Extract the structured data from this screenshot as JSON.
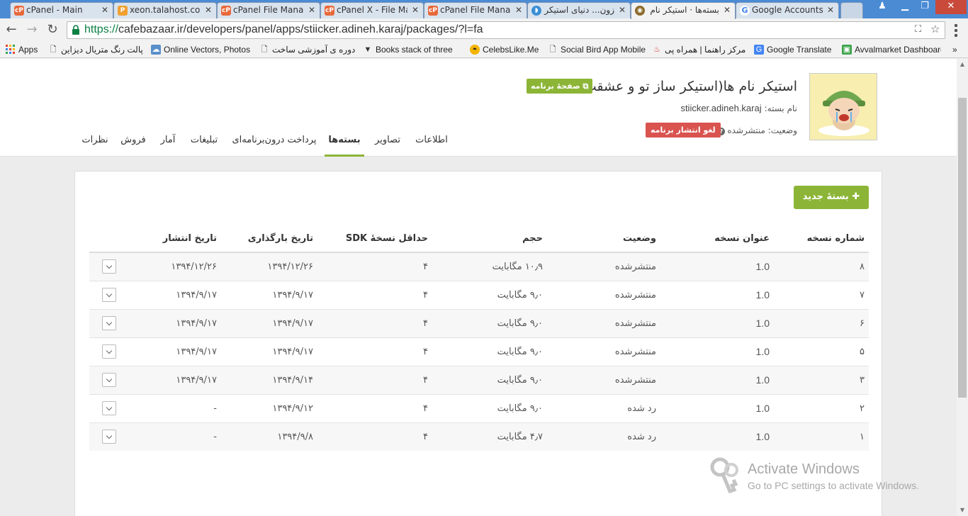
{
  "browser": {
    "tabs": [
      {
        "title": "cPanel - Main",
        "favicon": "cpanel-icon",
        "color": "#e8693b",
        "active": false
      },
      {
        "title": "xeon.talahost.com",
        "favicon": "pma-icon",
        "color": "#f0a030",
        "active": false
      },
      {
        "title": "cPanel File Manager",
        "favicon": "cpanel-icon",
        "color": "#e8693b",
        "active": false
      },
      {
        "title": "cPanel X - File Manager",
        "favicon": "cpanel-icon",
        "color": "#e8693b",
        "active": false
      },
      {
        "title": "cPanel File Manager",
        "favicon": "cpanel-icon",
        "color": "#e8693b",
        "active": false
      },
      {
        "title": "زون... دنیای استیکر",
        "favicon": "zoon-icon",
        "color": "#3a8fd6",
        "active": false
      },
      {
        "title": "بسته‌ها · استیکر نام ها",
        "favicon": "cafebazaar-icon",
        "color": "#8a6a2a",
        "active": true
      },
      {
        "title": "Google Accounts",
        "favicon": "google-icon",
        "color": "#4285f4",
        "active": false
      }
    ],
    "url_scheme": "https://",
    "url_rest": "cafebazaar.ir/developers/panel/apps/stiicker.adineh.karaj/packages/?l=fa",
    "bookmarks": [
      {
        "label": "Apps",
        "icon": "apps-grid-icon"
      },
      {
        "label": "پالت رنگ متریال دیزاین",
        "icon": "page-icon"
      },
      {
        "label": "Online Vectors, Photos",
        "icon": "cloud-icon"
      },
      {
        "label": "دوره ی آموزشی ساخت",
        "icon": "page-icon"
      },
      {
        "label": "Books stack of three",
        "icon": "book-icon"
      },
      {
        "label": "CelebsLike.Me",
        "icon": "sunglasses-icon"
      },
      {
        "label": "Social Bird App Mobile",
        "icon": "page-icon"
      },
      {
        "label": "مرکز راهنما | همراه پی",
        "icon": "flame-icon"
      },
      {
        "label": "Google Translate",
        "icon": "translate-icon"
      },
      {
        "label": "Avvalmarket Dashboard",
        "icon": "market-icon"
      }
    ]
  },
  "app": {
    "title": "استیکر نام ها(استیکر ساز تو و عشقت)",
    "page_link": "صفحهٔ برنامه",
    "package_label": "نام بسته:",
    "package_name": "stiicker.adineh.karaj",
    "status_label": "وضعیت: منتشرشده",
    "unpublish_label": "لغو انتشار برنامه"
  },
  "tabs": [
    {
      "label": "اطلاعات",
      "active": false
    },
    {
      "label": "تصاویر",
      "active": false
    },
    {
      "label": "بسته‌ها",
      "active": true
    },
    {
      "label": "پرداخت درون‌برنامه‌ای",
      "active": false
    },
    {
      "label": "تبلیغات",
      "active": false
    },
    {
      "label": "آمار",
      "active": false
    },
    {
      "label": "فروش",
      "active": false
    },
    {
      "label": "نظرات",
      "active": false
    }
  ],
  "packages": {
    "new_button": "بستهٔ جدید",
    "columns": [
      "شماره نسخه",
      "عنوان نسخه",
      "وضعیت",
      "حجم",
      "حداقل نسخهٔ SDK",
      "تاریخ بارگذاری",
      "تاریخ انتشار"
    ],
    "rows": [
      {
        "num": "۸",
        "title": "1.0",
        "status": "منتشرشده",
        "size": "۱۰٫۹ مگابایت",
        "sdk": "۴",
        "upload": "۱۳۹۴/۱۲/۲۶",
        "publish": "۱۳۹۴/۱۲/۲۶"
      },
      {
        "num": "۷",
        "title": "1.0",
        "status": "منتشرشده",
        "size": "۹٫۰ مگابایت",
        "sdk": "۴",
        "upload": "۱۳۹۴/۹/۱۷",
        "publish": "۱۳۹۴/۹/۱۷"
      },
      {
        "num": "۶",
        "title": "1.0",
        "status": "منتشرشده",
        "size": "۹٫۰ مگابایت",
        "sdk": "۴",
        "upload": "۱۳۹۴/۹/۱۷",
        "publish": "۱۳۹۴/۹/۱۷"
      },
      {
        "num": "۵",
        "title": "1.0",
        "status": "منتشرشده",
        "size": "۹٫۰ مگابایت",
        "sdk": "۴",
        "upload": "۱۳۹۴/۹/۱۷",
        "publish": "۱۳۹۴/۹/۱۷"
      },
      {
        "num": "۳",
        "title": "1.0",
        "status": "منتشرشده",
        "size": "۹٫۰ مگابایت",
        "sdk": "۴",
        "upload": "۱۳۹۴/۹/۱۴",
        "publish": "۱۳۹۴/۹/۱۷"
      },
      {
        "num": "۲",
        "title": "1.0",
        "status": "رد شده",
        "size": "۹٫۰ مگابایت",
        "sdk": "۴",
        "upload": "۱۳۹۴/۹/۱۲",
        "publish": "-"
      },
      {
        "num": "۱",
        "title": "1.0",
        "status": "رد شده",
        "size": "۴٫۷ مگابایت",
        "sdk": "۴",
        "upload": "۱۳۹۴/۹/۸",
        "publish": "-"
      }
    ]
  },
  "watermark": {
    "title": "Activate Windows",
    "subtitle": "Go to PC settings to activate Windows."
  },
  "colors": {
    "accent_green": "#8cb537",
    "danger_red": "#d9534f",
    "chrome_blue": "#4a8bd4"
  }
}
